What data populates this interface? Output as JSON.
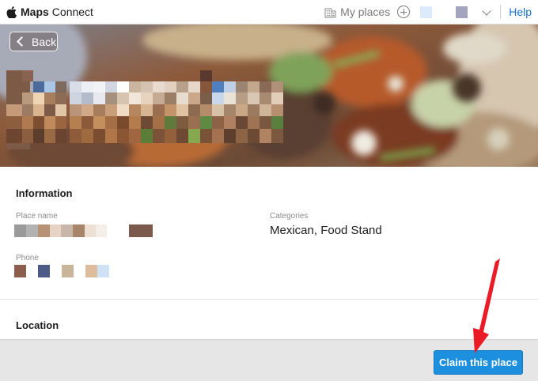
{
  "app": {
    "brand_strong": "Maps",
    "brand_rest": "Connect"
  },
  "topbar": {
    "my_places_label": "My places",
    "help_label": "Help",
    "icons": [
      "apple-logo-icon",
      "building-icon",
      "add-circle-icon",
      "chevron-down-icon"
    ],
    "swatch_colors": [
      "#dcebfb",
      "#a3a5bf"
    ]
  },
  "hero": {
    "back_label": "Back"
  },
  "information": {
    "title": "Information",
    "place_name_label": "Place name",
    "categories_label": "Categories",
    "categories_value": "Mexican, Food Stand",
    "phone_label": "Phone",
    "place_name_redaction_colors": [
      "#9a9a9a",
      "#b2b2b2",
      "#b89274",
      "#e6d3c6",
      "#c9b6aa",
      "#a88468",
      "#ede0d3",
      "#f3eee8",
      "#ffffff",
      "#ffffff",
      "#7b5a4d"
    ],
    "phone_redaction_colors": [
      "#8c5e4d",
      "#4d5a86",
      "#c9b59a",
      "#ddbd9e",
      "#cfe2f5"
    ]
  },
  "location": {
    "title": "Location"
  },
  "footer": {
    "claim_label": "Claim this place"
  },
  "colors": {
    "accent": "#1c8fdf",
    "link": "#1a73c7",
    "annotation_arrow": "#ea1b24"
  }
}
